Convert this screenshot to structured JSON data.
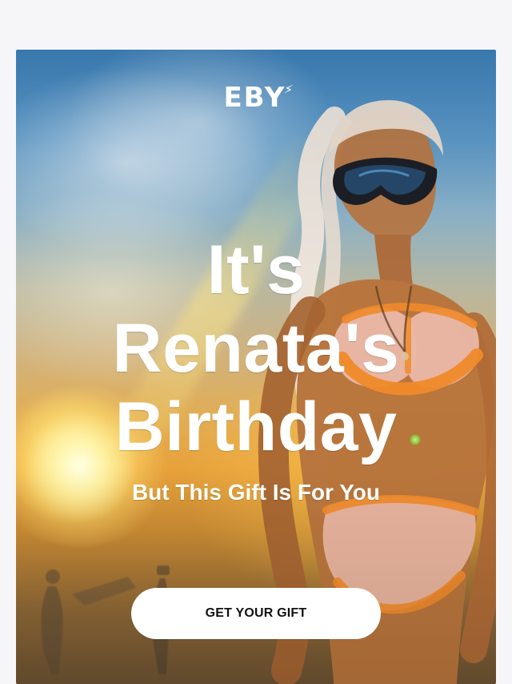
{
  "brand": {
    "logo_text": "EBY",
    "logo_mark_icon": "bolt-icon"
  },
  "hero": {
    "headline_lines": [
      "It's",
      "Renata's",
      "Birthday"
    ],
    "subheadline": "But This Gift Is For You"
  },
  "cta": {
    "label": "GET YOUR GIFT"
  },
  "colors": {
    "page_background": "#f6f6f8",
    "text_on_image": "#ffffff",
    "cta_background": "#ffffff",
    "cta_text": "#111111",
    "swimsuit_accent": "#f08a2a"
  }
}
